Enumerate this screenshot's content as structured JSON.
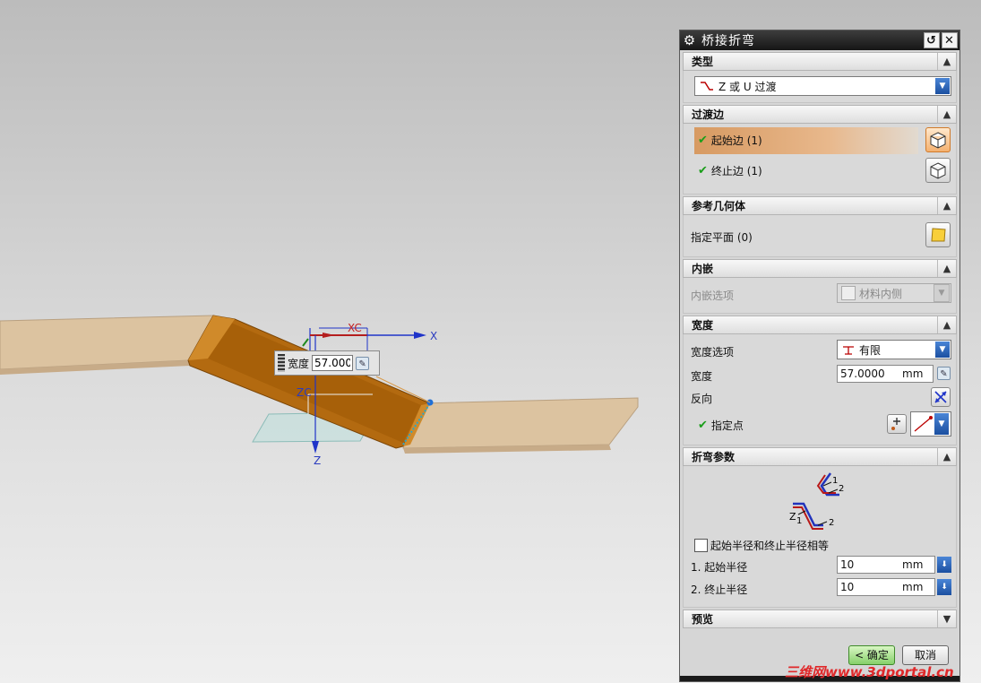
{
  "viewport": {
    "axes": {
      "x": "X",
      "xc": "XC",
      "zc": "ZC",
      "z": "Z"
    },
    "width_popup": {
      "label": "宽度",
      "value": "57.000"
    }
  },
  "dialog": {
    "title": "桥接折弯",
    "sections": {
      "type": {
        "header": "类型",
        "value": "Z 或 U 过渡"
      },
      "transition_edges": {
        "header": "过渡边",
        "start_edge": "起始边 (1)",
        "end_edge": "终止边 (1)"
      },
      "reference": {
        "header": "参考几何体",
        "plane": "指定平面 (0)"
      },
      "inset": {
        "header": "内嵌",
        "option_label": "内嵌选项",
        "option_value": "材料内侧"
      },
      "width": {
        "header": "宽度",
        "option_label": "宽度选项",
        "option_value": "有限",
        "width_label": "宽度",
        "width_value": "57.0000",
        "width_unit": "mm",
        "reverse_label": "反向",
        "point_label": "指定点"
      },
      "bend": {
        "header": "折弯参数",
        "equal_label": "起始半径和终止半径相等",
        "equal_checked": false,
        "start_label": "1. 起始半径",
        "start_value": "10",
        "start_unit": "mm",
        "end_label": "2. 终止半径",
        "end_value": "10",
        "end_unit": "mm"
      },
      "preview": {
        "header": "预览"
      }
    },
    "buttons": {
      "ok": "< 确定 >",
      "cancel": "取消"
    }
  },
  "watermark": "三维网www.3dportal.cn"
}
